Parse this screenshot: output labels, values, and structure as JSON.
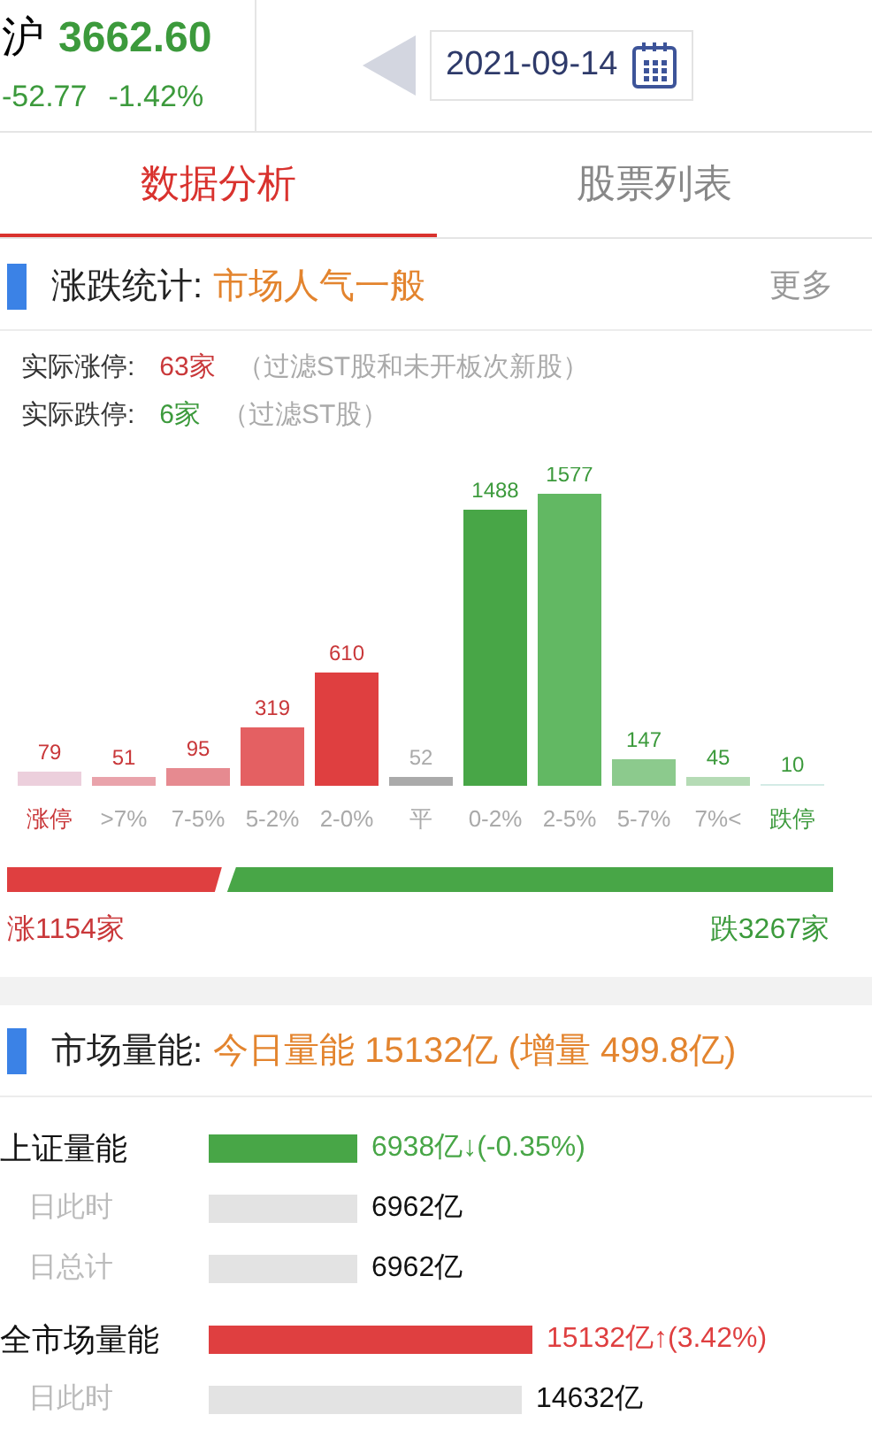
{
  "index": {
    "name": "沪",
    "value": "3662.60",
    "change": "-52.77",
    "percent": "-1.42%"
  },
  "date": "2021-09-14",
  "tabs": [
    {
      "label": "数据分析",
      "selected": true
    },
    {
      "label": "股票列表",
      "selected": false
    }
  ],
  "rise_fall": {
    "title": "涨跌统计:",
    "summary": "市场人气一般",
    "more": "更多",
    "limit_up": {
      "label": "实际涨停:",
      "count": "63家",
      "note": "（过滤ST股和未开板次新股）"
    },
    "limit_down": {
      "label": "实际跌停:",
      "count": "6家",
      "note": "（过滤ST股）"
    },
    "chart_data": {
      "type": "bar",
      "categories": [
        "涨停",
        ">7%",
        "7-5%",
        "5-2%",
        "2-0%",
        "平",
        "0-2%",
        "2-5%",
        "5-7%",
        "7%<",
        "跌停"
      ],
      "values": [
        79,
        51,
        95,
        319,
        610,
        52,
        1488,
        1577,
        147,
        45,
        10
      ],
      "data_labels": true,
      "colors": [
        "#eccfdc",
        "#e9a3ab",
        "#e68a90",
        "#e46062",
        "#df3f40",
        "#aaaaaa",
        "#48a647",
        "#62b863",
        "#8cca8d",
        "#b5dbb5",
        "#d4ebe6"
      ]
    },
    "ratio": {
      "level": 0.26
    },
    "up_total": "涨1154家",
    "down_total": "跌3267家"
  },
  "volume": {
    "title": "市场量能:",
    "summary": "今日量能 15132亿 (增量 499.8亿)",
    "rows": [
      {
        "label": "上证量能",
        "kind": "main",
        "reading": "6938亿↓(-0.35%)",
        "color": "#48a647"
      },
      {
        "label": "日此时",
        "kind": "sub",
        "reading": "6962亿"
      },
      {
        "label": "日总计",
        "kind": "sub",
        "reading": "6962亿"
      },
      {
        "label": "全市场量能",
        "kind": "main",
        "reading": "15132亿↑(3.42%)",
        "color": "#df3f40"
      },
      {
        "label": "日此时",
        "kind": "sub",
        "reading": "14632亿"
      }
    ]
  }
}
